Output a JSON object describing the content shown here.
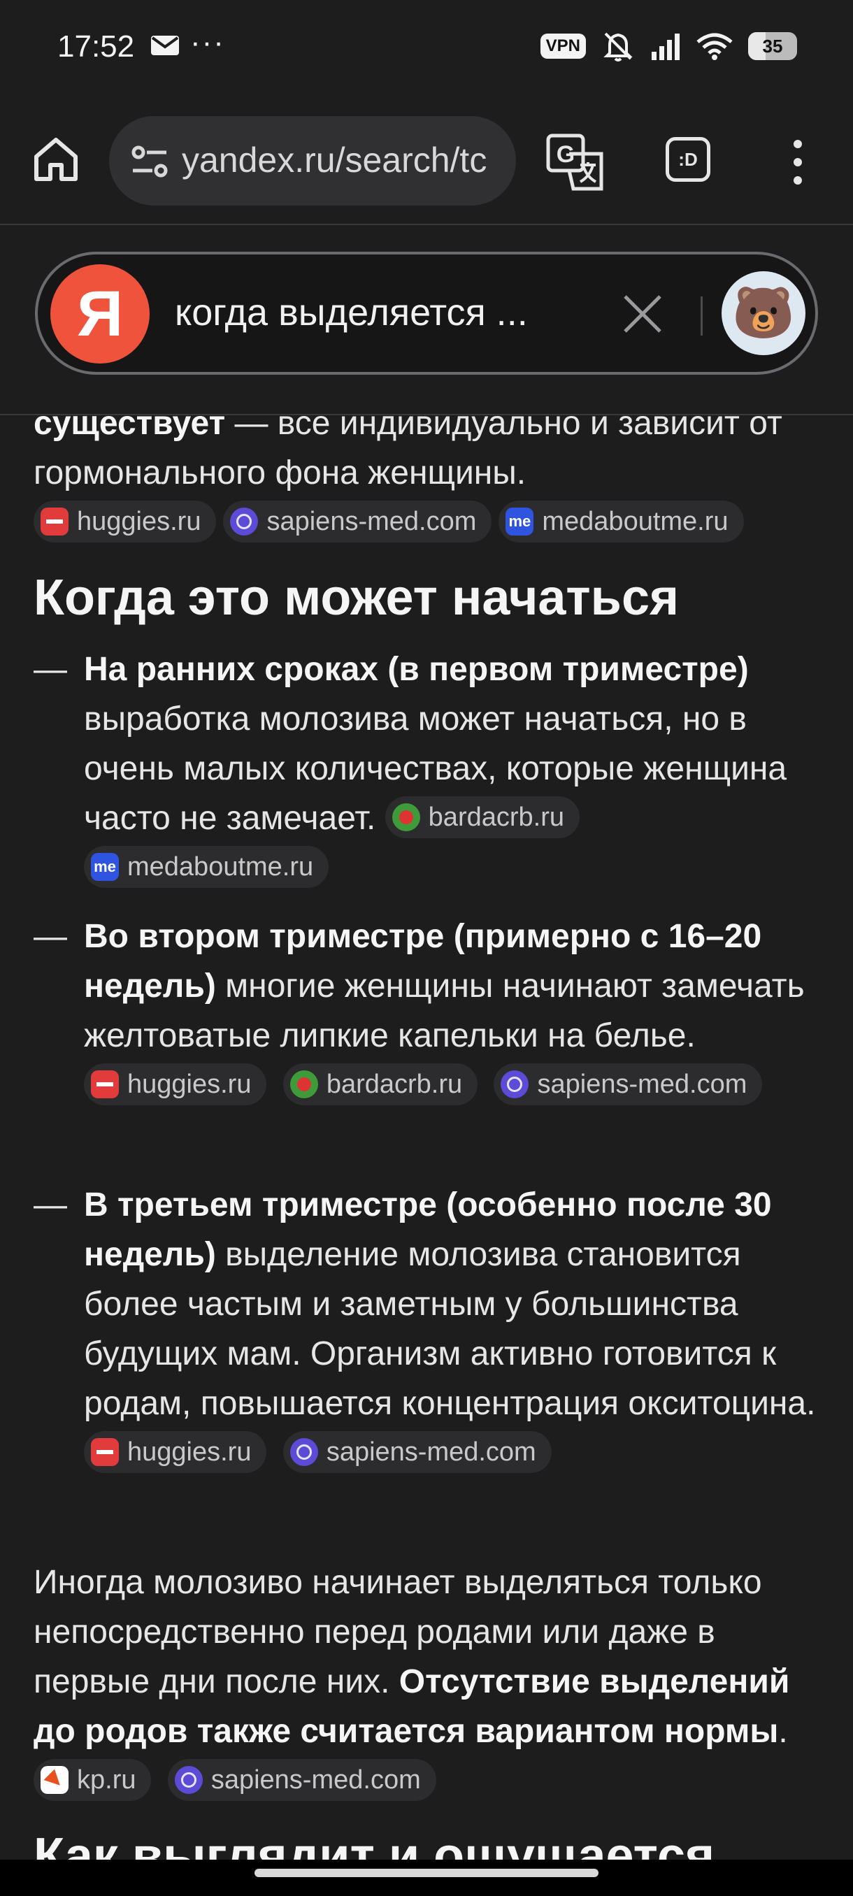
{
  "status_bar": {
    "time": "17:52",
    "overflow": "···",
    "vpn_label": "VPN",
    "battery_level": "35",
    "icons": [
      "mail-icon",
      "mute-icon",
      "signal-icon",
      "wifi-icon"
    ]
  },
  "browser": {
    "url": "yandex.ru/search/tc",
    "tabs_label": ":D",
    "icons": [
      "home-icon",
      "site-settings-icon",
      "translate-icon",
      "menu-icon"
    ]
  },
  "search": {
    "logo_letter": "Я",
    "query": "когда выделяется ...",
    "avatar_emoji": "🐻"
  },
  "answer": {
    "intro": {
      "bold": "существует",
      "text": " — всё индивидуально и зависит от гормонального фона женщины.",
      "sources": [
        "huggies.ru",
        "sapiens-med.com",
        "medaboutme.ru"
      ]
    },
    "heading": "Когда это может начаться",
    "items": [
      {
        "dash": "—",
        "bold": "На ранних сроках (в первом триместре)",
        "text": " выработка молозива может начаться, но в очень малых количествах, которые женщина часто не замечает.",
        "sources": [
          "bardacrb.ru",
          "medaboutme.ru"
        ]
      },
      {
        "dash": "—",
        "bold": "Во втором триместре (примерно с 16–20 недель)",
        "text": " многие женщины начинают замечать желтоватые липкие капельки на белье.",
        "sources": [
          "huggies.ru",
          "bardacrb.ru",
          "sapiens-med.com"
        ]
      },
      {
        "dash": "—",
        "bold": "В третьем триместре (особенно после 30 недель)",
        "text": " выделение молозива становится более частым и заметным у большинства будущих мам. Организм активно готовится к родам, повышается концентрация окситоцина.",
        "sources": [
          "huggies.ru",
          "sapiens-med.com"
        ]
      }
    ],
    "closing": {
      "text": "Иногда молозиво начинает выделяться только непосредственно перед родами или даже в первые дни после них. ",
      "bold": "Отсутствие выделений до родов также считается вариантом нормы",
      "tail": ".",
      "sources": [
        "kp.ru",
        "sapiens-med.com"
      ]
    },
    "next_heading": "Как выглядит и ощущается"
  }
}
